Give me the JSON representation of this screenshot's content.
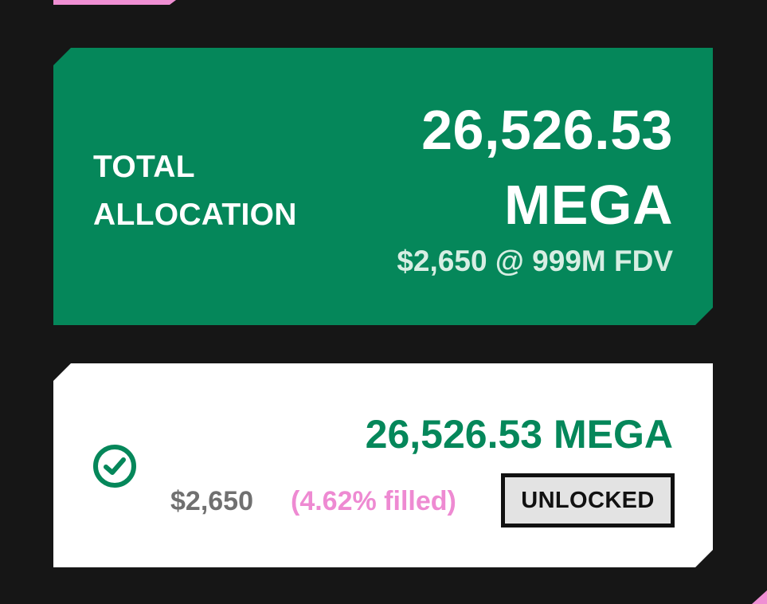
{
  "total_allocation": {
    "label_line1": "TOTAL",
    "label_line2": "ALLOCATION",
    "amount_number": "26,526.53",
    "amount_token": "MEGA",
    "usd_value_fdv": "$2,650 @ 999M FDV"
  },
  "allocation_entry": {
    "amount": "26,526.53 MEGA",
    "usd_value": "$2,650",
    "fill_status": "(4.62% filled)",
    "status_badge": "UNLOCKED",
    "icon": "check-circle-icon"
  },
  "colors": {
    "background": "#161616",
    "brand_green": "#05875a",
    "accent_pink": "#ef8fd3",
    "badge_background": "#e3e3e3"
  }
}
